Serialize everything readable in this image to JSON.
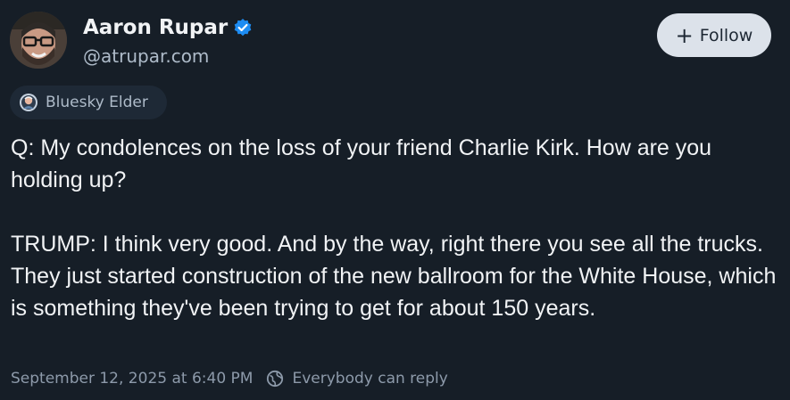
{
  "author": {
    "name": "Aaron Rupar",
    "handle": "@atrupar.com",
    "verified": true
  },
  "follow_button": {
    "label": "Follow",
    "icon": "plus-icon"
  },
  "badge": {
    "label": "Bluesky Elder",
    "icon": "elder-badge-icon"
  },
  "post": {
    "text": "Q: My condolences on the loss of your friend Charlie Kirk. How are you holding up?\n\nTRUMP: I think very good. And by the way, right there you see all the trucks. They just started construction of the new ballroom for the White House, which is something they've been trying to get for about 150 years."
  },
  "meta": {
    "timestamp": "September 12, 2025 at 6:40 PM",
    "reply_setting": "Everybody can reply",
    "reply_icon": "globe-reply-icon"
  },
  "colors": {
    "background": "#161e27",
    "text_primary": "#f1f3f5",
    "text_secondary": "#aebbc9",
    "verified_blue": "#1d8cf2",
    "follow_bg": "#dce2ea"
  }
}
